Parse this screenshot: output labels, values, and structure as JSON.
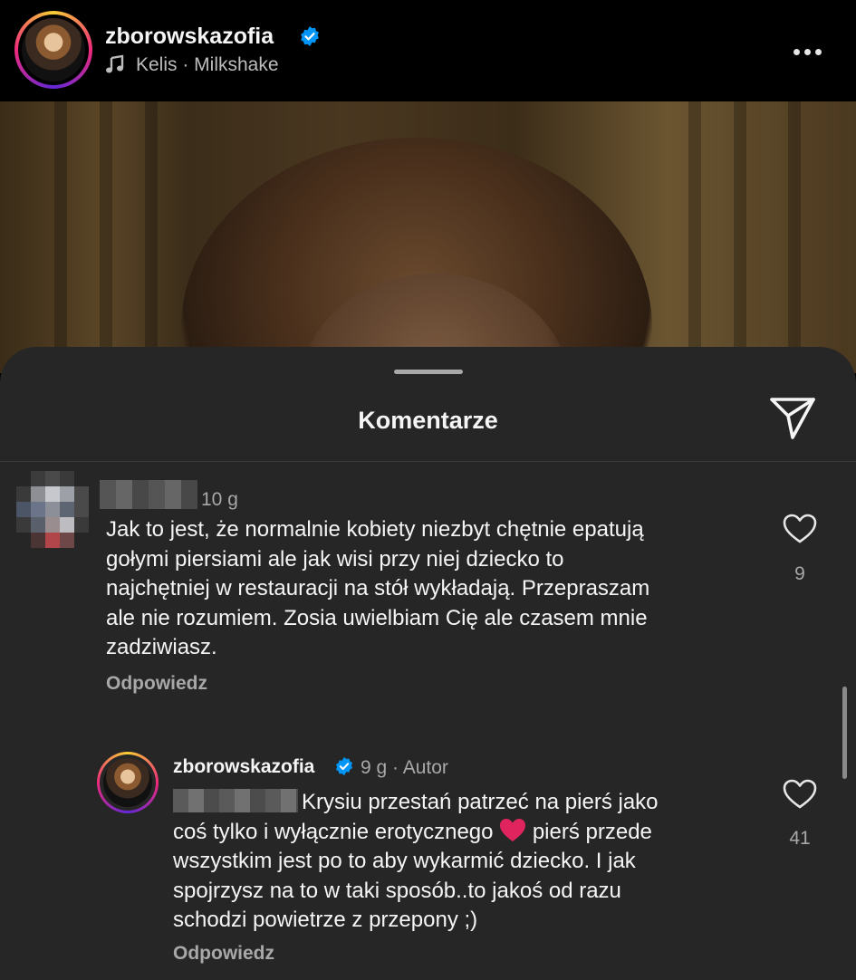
{
  "header": {
    "username": "zborowskazofia",
    "song": "Kelis · Milkshake"
  },
  "sheet": {
    "title": "Komentarze"
  },
  "comments": [
    {
      "time": "10 g",
      "text": "Jak to jest, że normalnie kobiety niezbyt chętnie epatują\ngołymi piersiami ale jak wisi przy niej dziecko to\nnajchętniej w restauracji na stół wykładają. Przepraszam\nale nie rozumiem. Zosia uwielbiam Cię ale czasem mnie\nzadziwiasz.",
      "reply_label": "Odpowiedz",
      "likes": "9"
    }
  ],
  "reply": {
    "username": "zborowskazofia",
    "time": "9 g",
    "separator": "·",
    "author_label": "Autor",
    "text_line1": "Krysiu przestań patrzeć na pierś jako",
    "text_line2a": "coś tylko i wyłącznie erotycznego ",
    "text_line2b": " pierś przede",
    "text_rest": "wszystkim jest po to aby wykarmić dziecko. I jak\nspojrzysz na to w taki sposób..to jakoś od razu\nschodzi powietrze z przepony ;)",
    "reply_label": "Odpowiedz",
    "likes": "41"
  },
  "colors": {
    "background": "#000000",
    "sheet": "#262626",
    "text": "#f5f5f5",
    "muted": "#a8a8a8",
    "verified": "#0095f6",
    "heart_emoji": "#e0245e"
  }
}
